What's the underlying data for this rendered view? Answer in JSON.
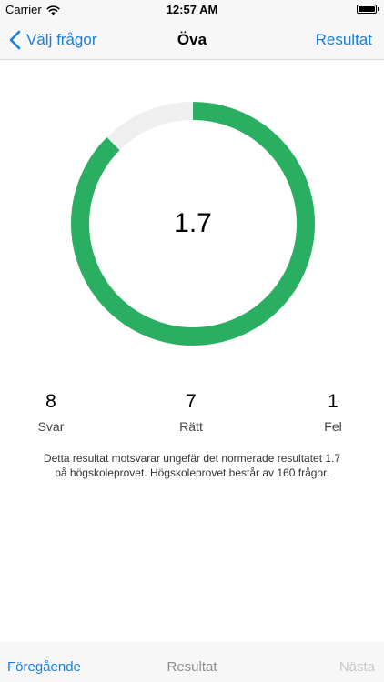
{
  "status_bar": {
    "carrier": "Carrier",
    "time": "12:57 AM"
  },
  "nav": {
    "back_label": "Välj frågor",
    "title": "Öva",
    "right_label": "Resultat"
  },
  "gauge": {
    "value_label": "1.7",
    "filled_fraction": 0.875,
    "fill_color": "#2aaf62",
    "track_color": "#efefef"
  },
  "stats": {
    "svar_value": "8",
    "svar_label": "Svar",
    "ratt_value": "7",
    "ratt_label": "Rätt",
    "fel_value": "1",
    "fel_label": "Fel"
  },
  "description": "Detta resultat motsvarar ungefär det normerade resultatet 1.7 på högskoleprovet. Högskoleprovet består av 160 frågor.",
  "toolbar": {
    "previous_label": "Föregående",
    "result_label": "Resultat",
    "next_label": "Nästa"
  },
  "colors": {
    "accent": "#1a7ee0",
    "disabled": "#c7c7cc"
  }
}
